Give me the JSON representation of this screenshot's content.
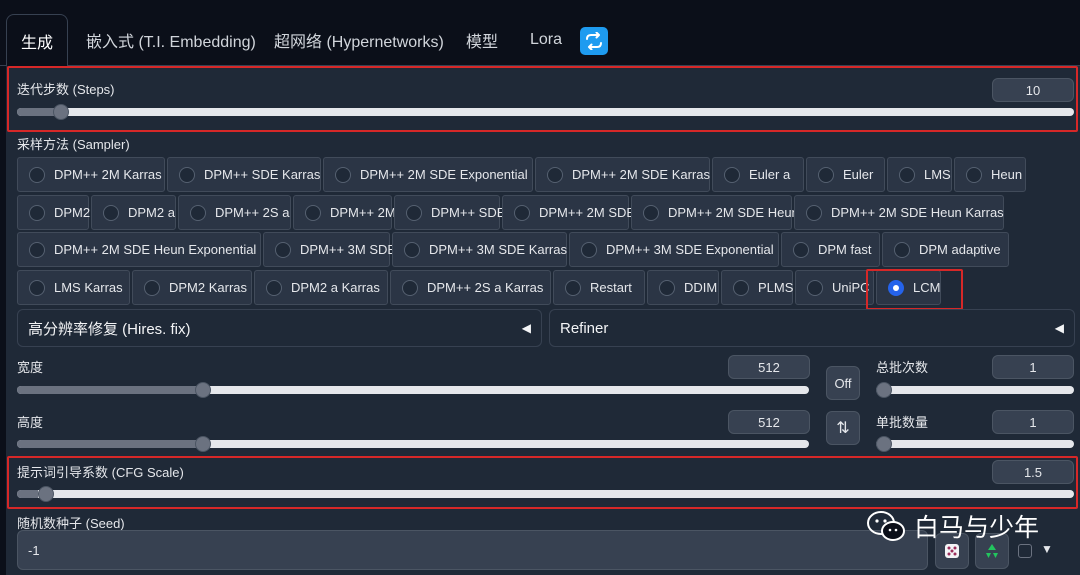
{
  "tabs": [
    "生成",
    "嵌入式 (T.I. Embedding)",
    "超网络 (Hypernetworks)",
    "模型",
    "Lora"
  ],
  "steps": {
    "label": "迭代步数 (Steps)",
    "value": "10",
    "fraction": 0.035
  },
  "sampler": {
    "label": "采样方法 (Sampler)",
    "selected": "LCM",
    "rows": [
      [
        "DPM++ 2M Karras",
        "DPM++ SDE Karras",
        "DPM++ 2M SDE Exponential",
        "DPM++ 2M SDE Karras",
        "Euler a",
        "Euler",
        "LMS",
        "Heun"
      ],
      [
        "DPM2",
        "DPM2 a",
        "DPM++ 2S a",
        "DPM++ 2M",
        "DPM++ SDE",
        "DPM++ 2M SDE",
        "DPM++ 2M SDE Heun",
        "DPM++ 2M SDE Heun Karras"
      ],
      [
        "DPM++ 2M SDE Heun Exponential",
        "DPM++ 3M SDE",
        "DPM++ 3M SDE Karras",
        "DPM++ 3M SDE Exponential",
        "DPM fast",
        "DPM adaptive"
      ],
      [
        "LMS Karras",
        "DPM2 Karras",
        "DPM2 a Karras",
        "DPM++ 2S a Karras",
        "Restart",
        "DDIM",
        "PLMS",
        "UniPC",
        "LCM"
      ]
    ]
  },
  "hires": {
    "label": "高分辨率修复 (Hires. fix)"
  },
  "refiner": {
    "label": "Refiner"
  },
  "width": {
    "label": "宽度",
    "value": "512",
    "fraction": 0.23
  },
  "height": {
    "label": "高度",
    "value": "512",
    "fraction": 0.23
  },
  "batch_count": {
    "label": "总批次数",
    "value": "1",
    "fraction": 0.0
  },
  "batch_size": {
    "label": "单批数量",
    "value": "1",
    "fraction": 0.0
  },
  "off_label": "Off",
  "swap_label": "⇅",
  "cfg": {
    "label": "提示词引导系数 (CFG Scale)",
    "value": "1.5",
    "fraction": 0.02
  },
  "seed": {
    "label": "随机数种子 (Seed)",
    "value": "-1"
  },
  "watermark": "白马与少年",
  "colors": {
    "accent": "#1e9bf0",
    "highlight": "#d62828",
    "radio_selected": "#2563eb"
  }
}
